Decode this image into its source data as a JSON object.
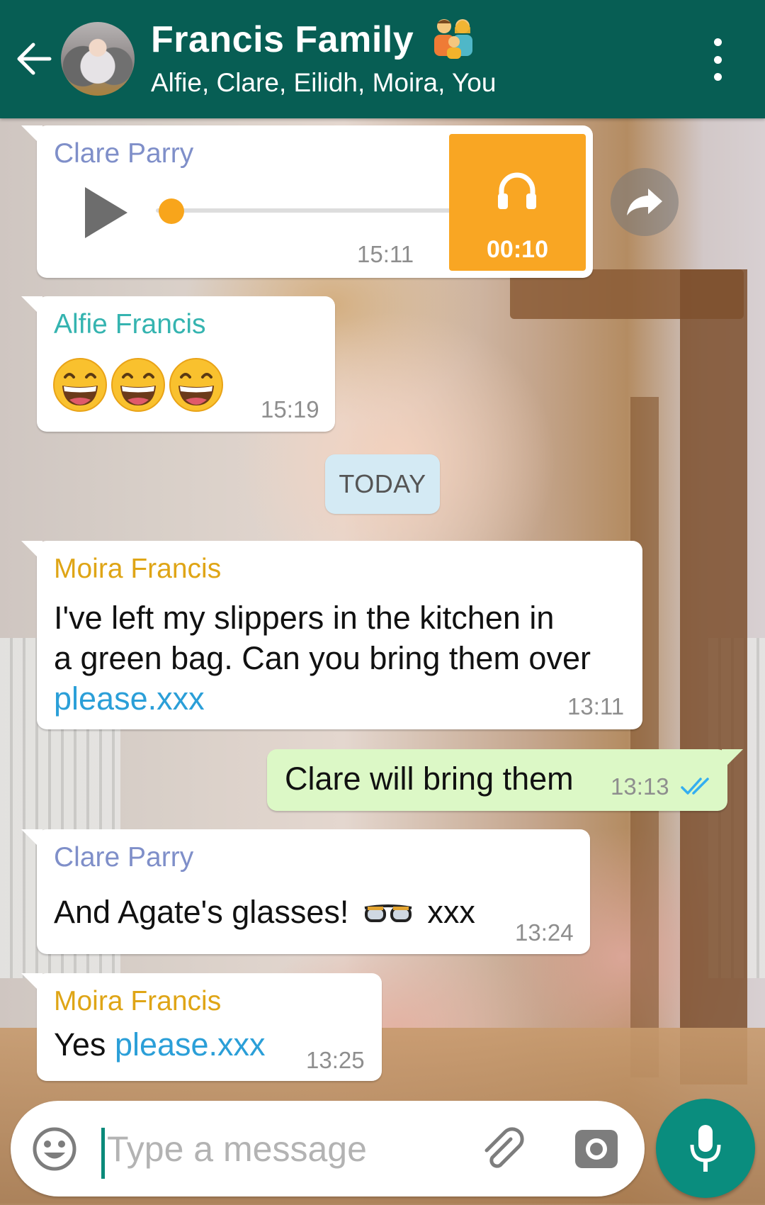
{
  "header": {
    "title": "Francis Family",
    "members": "Alfie, Clare, Eilidh, Moira, You",
    "back_icon": "arrow-left-icon",
    "menu_icon": "more-vert-icon"
  },
  "colors": {
    "header": "#075e54",
    "accent": "#0a8d7e",
    "incoming_bubble": "#ffffff",
    "outgoing_bubble": "#dcf8c6",
    "link": "#2b9fd8",
    "sender_clare": "#7f8fc9",
    "sender_alfie": "#35b4b0",
    "sender_moira": "#dfa516",
    "voice_accent": "#f9a623"
  },
  "messages": {
    "voice": {
      "sender": "Clare Parry",
      "time": "15:11",
      "duration": "00:10",
      "progress": 0.0
    },
    "alfie": {
      "sender": "Alfie Francis",
      "emoji": [
        "grinning-face",
        "grinning-face",
        "grinning-face"
      ],
      "time": "15:19"
    },
    "date_divider": "TODAY",
    "moira1": {
      "sender": "Moira Francis",
      "line1": "I've left my slippers in the kitchen in",
      "line2": "a green bag. Can you bring them over",
      "link": "please.xxx",
      "time": "13:11"
    },
    "mine": {
      "text": "Clare will bring them",
      "time": "13:13",
      "status": "read"
    },
    "clare2": {
      "sender": "Clare Parry",
      "text_before": "And Agate's glasses!",
      "emoji": "glasses",
      "text_after": "xxx",
      "time": "13:24"
    },
    "moira2": {
      "sender": "Moira Francis",
      "text": "Yes",
      "link": "please.xxx",
      "time": "13:25"
    }
  },
  "input": {
    "placeholder": "Type a message"
  }
}
